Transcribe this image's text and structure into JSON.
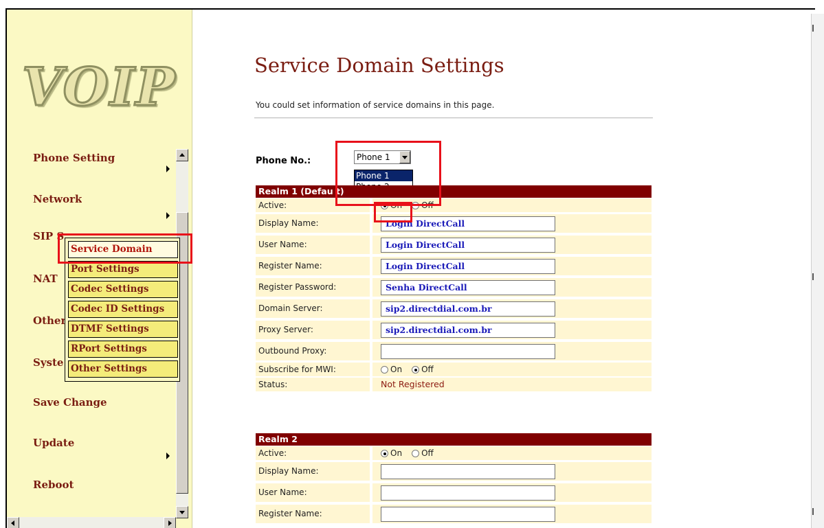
{
  "logo": {
    "text": "VOIP"
  },
  "nav": {
    "items": [
      {
        "label": "Phone Setting",
        "has_submenu": true
      },
      {
        "label": "Network",
        "has_submenu": true
      },
      {
        "label": "SIP S"
      },
      {
        "label": "NAT"
      },
      {
        "label": "Other"
      },
      {
        "label": "Syste"
      },
      {
        "label": "Save Change",
        "has_submenu": false
      },
      {
        "label": "Update",
        "has_submenu": true
      },
      {
        "label": "Reboot",
        "has_submenu": false
      }
    ],
    "submenu": [
      {
        "label": "Service Domain",
        "active": true
      },
      {
        "label": "Port Settings"
      },
      {
        "label": "Codec Settings"
      },
      {
        "label": "Codec ID Settings"
      },
      {
        "label": "DTMF Settings"
      },
      {
        "label": "RPort Settings"
      },
      {
        "label": "Other Settings"
      }
    ]
  },
  "page": {
    "title": "Service Domain Settings",
    "description": "You could set information of service domains in this page."
  },
  "phone": {
    "label": "Phone No.:",
    "selected": "Phone 1",
    "options": [
      "Phone 1",
      "Phone 2"
    ]
  },
  "realm1": {
    "header": "Realm 1 (Defau t)",
    "labels": {
      "active": "Active:",
      "display_name": "Display Name:",
      "user_name": "User Name:",
      "register_name": "Register Name:",
      "register_password": "Register Password:",
      "domain_server": "Domain Server:",
      "proxy_server": "Proxy Server:",
      "outbound_proxy": "Outbound Proxy:",
      "subscribe_mwi": "Subscribe for MWI:",
      "status": "Status:"
    },
    "on_label": "On",
    "off_label": "Off",
    "active": "On",
    "display_name": "Login DirectCall",
    "user_name": "Login DirectCall",
    "register_name": "Login DirectCall",
    "register_password": "Senha DirectCall",
    "domain_server": "sip2.directdial.com.br",
    "proxy_server": "sip2.directdial.com.br",
    "outbound_proxy": "",
    "subscribe_mwi": "Off",
    "status": "Not Registered"
  },
  "realm2": {
    "header": "Realm 2",
    "labels": {
      "active": "Active:",
      "display_name": "Display Name:",
      "user_name": "User Name:",
      "register_name": "Register Name:"
    },
    "on_label": "On",
    "off_label": "Off",
    "active": "On",
    "display_name": "",
    "user_name": "",
    "register_name": ""
  },
  "colors": {
    "sidebar_bg": "#fbf9c4",
    "nav_text": "#7a1d12",
    "section_header": "#800000",
    "row_bg": "#fff6d2",
    "field_text": "#1a1ab8",
    "highlight": "#e8101a"
  }
}
